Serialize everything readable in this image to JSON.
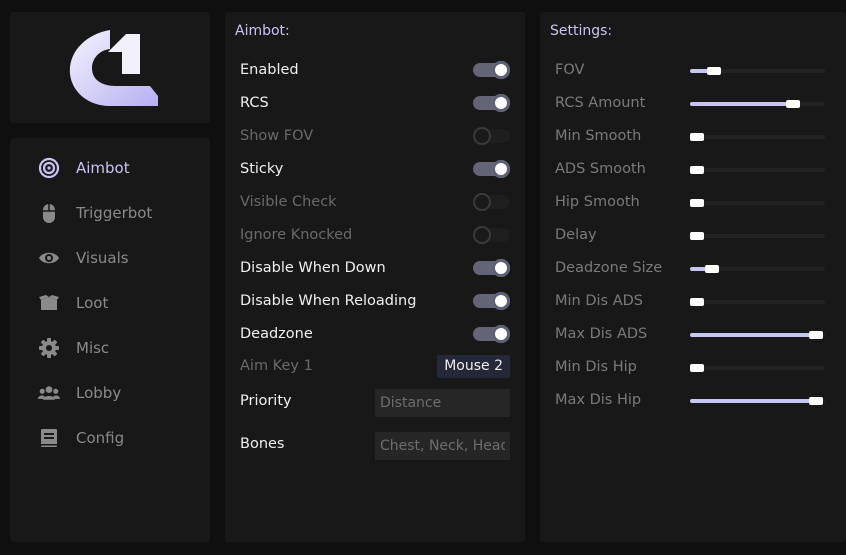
{
  "nav": {
    "items": [
      {
        "label": "Aimbot",
        "icon": "target-icon",
        "active": true
      },
      {
        "label": "Triggerbot",
        "icon": "mouse-icon",
        "active": false
      },
      {
        "label": "Visuals",
        "icon": "eye-icon",
        "active": false
      },
      {
        "label": "Loot",
        "icon": "box-icon",
        "active": false
      },
      {
        "label": "Misc",
        "icon": "gear-icon",
        "active": false
      },
      {
        "label": "Lobby",
        "icon": "users-icon",
        "active": false
      },
      {
        "label": "Config",
        "icon": "book-icon",
        "active": false
      }
    ]
  },
  "aimbot": {
    "title": "Aimbot:",
    "toggles": [
      {
        "label": "Enabled",
        "on": true
      },
      {
        "label": "RCS",
        "on": true
      },
      {
        "label": "Show FOV",
        "on": false
      },
      {
        "label": "Sticky",
        "on": true
      },
      {
        "label": "Visible Check",
        "on": false
      },
      {
        "label": "Ignore Knocked",
        "on": false
      },
      {
        "label": "Disable When Down",
        "on": true
      },
      {
        "label": "Disable When Reloading",
        "on": true
      },
      {
        "label": "Deadzone",
        "on": true
      }
    ],
    "aim_key": {
      "label": "Aim Key 1",
      "value": "Mouse 2"
    },
    "priority": {
      "label": "Priority",
      "placeholder": "Distance"
    },
    "bones": {
      "label": "Bones",
      "placeholder": "Chest, Neck, Head"
    }
  },
  "settings": {
    "title": "Settings:",
    "sliders": [
      {
        "label": "FOV",
        "value": 0.18
      },
      {
        "label": "RCS Amount",
        "value": 0.76
      },
      {
        "label": "Min Smooth",
        "value": 0.05
      },
      {
        "label": "ADS Smooth",
        "value": 0.05
      },
      {
        "label": "Hip Smooth",
        "value": 0.05
      },
      {
        "label": "Delay",
        "value": 0.05
      },
      {
        "label": "Deadzone Size",
        "value": 0.16
      },
      {
        "label": "Min Dis ADS",
        "value": 0.05
      },
      {
        "label": "Max Dis ADS",
        "value": 0.93
      },
      {
        "label": "Min Dis Hip",
        "value": 0.05
      },
      {
        "label": "Max Dis Hip",
        "value": 0.93
      }
    ]
  },
  "colors": {
    "accent": "#c9c4f3",
    "panel": "#181818",
    "background": "#0f0f0f"
  }
}
